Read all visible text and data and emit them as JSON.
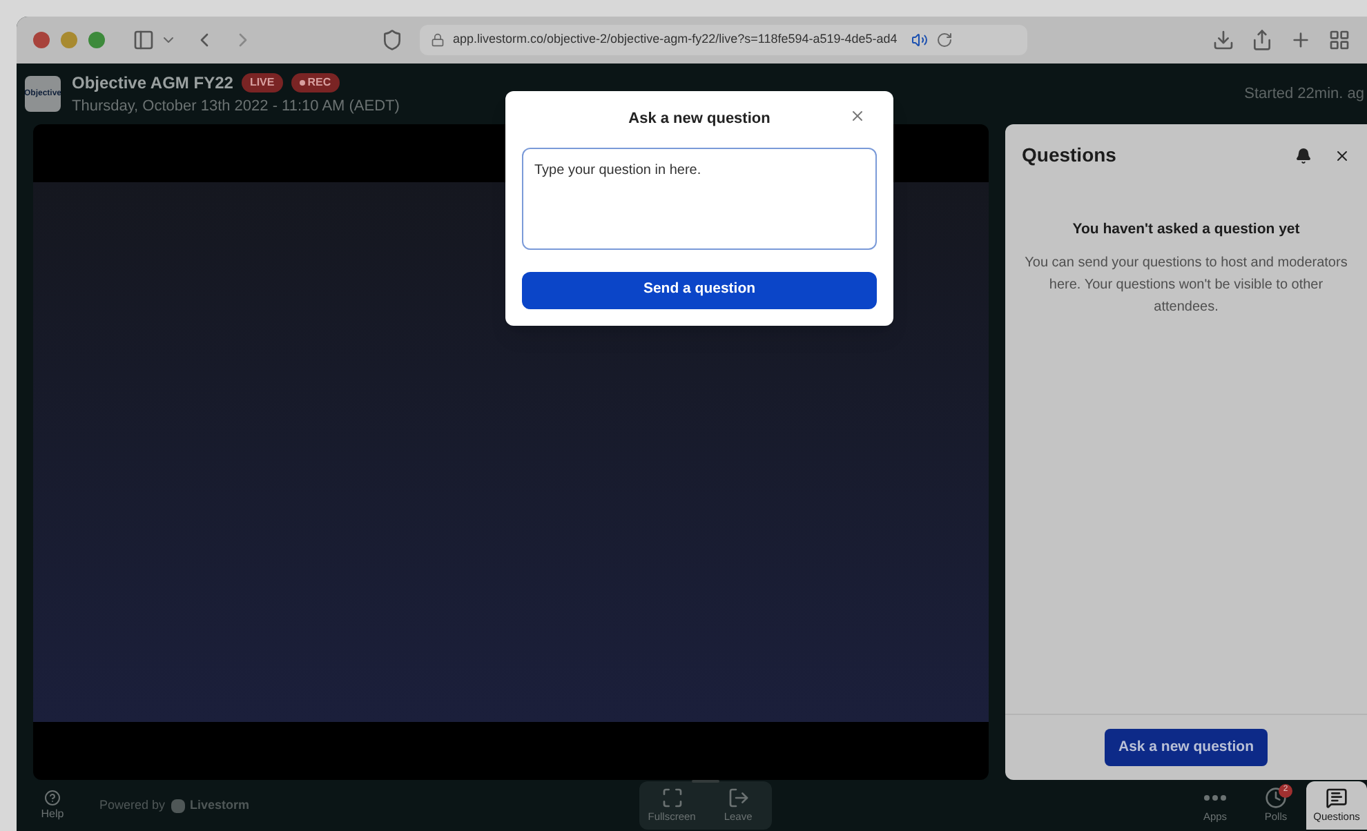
{
  "browser": {
    "url": "app.livestorm.co/objective-2/objective-agm-fy22/live?s=118fe594-a519-4de5-ad4"
  },
  "header": {
    "logo": "Objective",
    "title": "Objective AGM FY22",
    "badges": [
      {
        "label": "LIVE",
        "kind": "live"
      },
      {
        "label": "REC",
        "kind": "rec"
      }
    ],
    "date": "Thursday, October 13th 2022 - 11:10 AM (AEDT)",
    "started": "Started 22min. ag"
  },
  "modal": {
    "title": "Ask a new question",
    "value": "Type your question in here. ",
    "submit": "Send a question"
  },
  "questions_panel": {
    "title": "Questions",
    "empty_title": "You haven't asked a question yet",
    "empty_text": "You can send your questions to host and moderators here. Your questions won't be visible to other attendees.",
    "ask_button": "Ask a new question"
  },
  "footer": {
    "help": "Help",
    "powered_by": "Powered by",
    "brand": "Livestorm",
    "center_buttons": [
      {
        "label": "Fullscreen",
        "kind": "fullscreen"
      },
      {
        "label": "Leave",
        "kind": "leave"
      }
    ],
    "right_buttons": [
      {
        "label": "Apps",
        "kind": "apps",
        "selected": false
      },
      {
        "label": "Polls",
        "kind": "polls",
        "badge": "2",
        "selected": false
      },
      {
        "label": "Questions",
        "kind": "questions",
        "selected": true
      }
    ]
  }
}
